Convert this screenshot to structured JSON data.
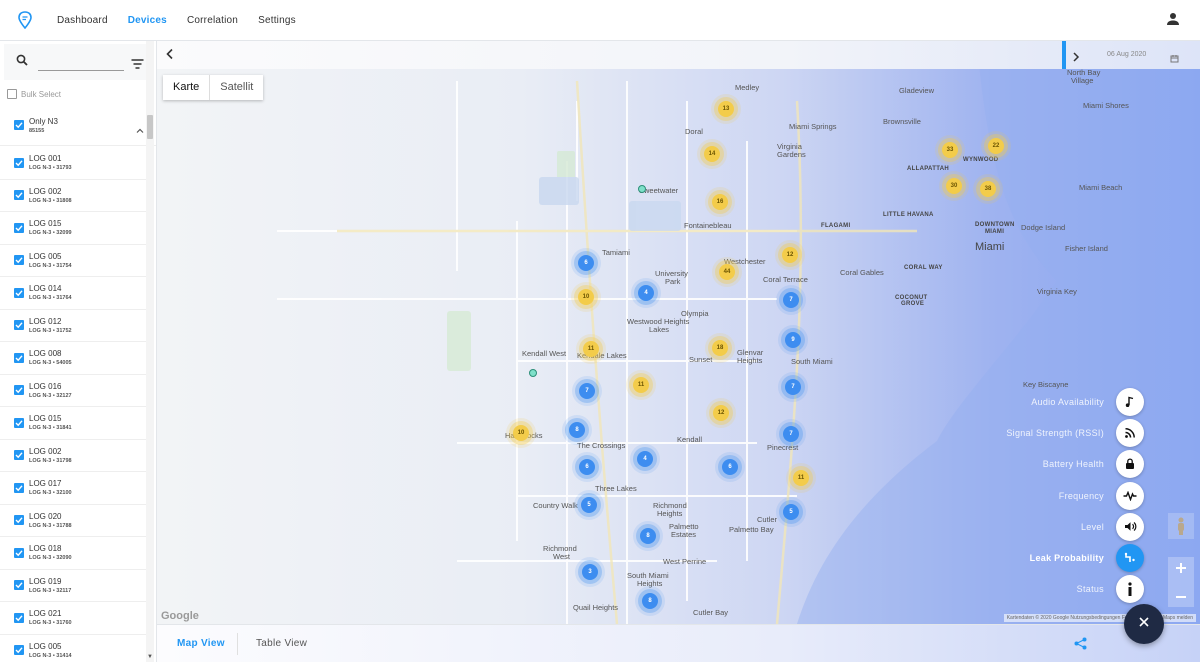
{
  "nav": {
    "items": [
      {
        "label": "Dashboard",
        "active": false
      },
      {
        "label": "Devices",
        "active": true
      },
      {
        "label": "Correlation",
        "active": false
      },
      {
        "label": "Settings",
        "active": false
      }
    ],
    "accent_color": "#2196f3"
  },
  "sidebar": {
    "search": {
      "value": "",
      "placeholder": ""
    },
    "bulk_select_label": "Bulk Select",
    "group": {
      "title": "Only N3",
      "subtitle": "85155",
      "checked": true
    },
    "items": [
      {
        "name": "LOG 001",
        "sub": "LOG N-3 • 31793"
      },
      {
        "name": "LOG 002",
        "sub": "LOG N-3 • 31808"
      },
      {
        "name": "LOG 015",
        "sub": "LOG N-3 • 32099"
      },
      {
        "name": "LOG 005",
        "sub": "LOG N-3 • 31754"
      },
      {
        "name": "LOG 014",
        "sub": "LOG N-3 • 31764"
      },
      {
        "name": "LOG 012",
        "sub": "LOG N-3 • 31752"
      },
      {
        "name": "LOG 008",
        "sub": "LOG N-3 • 54005"
      },
      {
        "name": "LOG 016",
        "sub": "LOG N-3 • 32127"
      },
      {
        "name": "LOG 015",
        "sub": "LOG N-3 • 31841"
      },
      {
        "name": "LOG 002",
        "sub": "LOG N-3 • 31798"
      },
      {
        "name": "LOG 017",
        "sub": "LOG N-3 • 32100"
      },
      {
        "name": "LOG 020",
        "sub": "LOG N-3 • 31788"
      },
      {
        "name": "LOG 018",
        "sub": "LOG N-3 • 32090"
      },
      {
        "name": "LOG 019",
        "sub": "LOG N-3 • 32117"
      },
      {
        "name": "LOG 021",
        "sub": "LOG N-3 • 31760"
      },
      {
        "name": "LOG 005",
        "sub": "LOG N-3 • 31414"
      }
    ]
  },
  "map": {
    "date": "06 Aug 2020",
    "map_type": {
      "map": "Karte",
      "satellite": "Satellit"
    },
    "places": [
      {
        "label": "Medley",
        "cls": "",
        "pos": "left:578px;top:42px"
      },
      {
        "label": "Doral",
        "cls": "",
        "pos": "left:528px;top:86px"
      },
      {
        "label": "Miami Springs",
        "cls": "",
        "pos": "left:632px;top:81px"
      },
      {
        "label": "Virginia",
        "cls": "",
        "pos": "left:620px;top:101px"
      },
      {
        "label": "Gardens",
        "cls": "",
        "pos": "left:620px;top:109px"
      },
      {
        "label": "Sweetwater",
        "cls": "",
        "pos": "left:482px;top:145px"
      },
      {
        "label": "Fontainebleau",
        "cls": "",
        "pos": "left:527px;top:180px"
      },
      {
        "label": "FLAGAMI",
        "cls": "bold",
        "pos": "left:664px;top:182px"
      },
      {
        "label": "Tamiami",
        "cls": "",
        "pos": "left:445px;top:207px"
      },
      {
        "label": "Westchester",
        "cls": "",
        "pos": "left:567px;top:216px"
      },
      {
        "label": "University",
        "cls": "",
        "pos": "left:498px;top:228px"
      },
      {
        "label": "Park",
        "cls": "",
        "pos": "left:508px;top:236px"
      },
      {
        "label": "Coral Terrace",
        "cls": "",
        "pos": "left:606px;top:234px"
      },
      {
        "label": "Coral Gables",
        "cls": "",
        "pos": "left:683px;top:227px"
      },
      {
        "label": "Olympia",
        "cls": "",
        "pos": "left:524px;top:268px"
      },
      {
        "label": "Westwood Heights",
        "cls": "",
        "pos": "left:470px;top:276px"
      },
      {
        "label": "Lakes",
        "cls": "",
        "pos": "left:492px;top:284px"
      },
      {
        "label": "Kendall West",
        "cls": "",
        "pos": "left:365px;top:308px"
      },
      {
        "label": "Kendale Lakes",
        "cls": "",
        "pos": "left:420px;top:310px"
      },
      {
        "label": "Sunset",
        "cls": "",
        "pos": "left:532px;top:314px"
      },
      {
        "label": "Glenvar",
        "cls": "",
        "pos": "left:580px;top:307px"
      },
      {
        "label": "Heights",
        "cls": "",
        "pos": "left:580px;top:315px"
      },
      {
        "label": "South Miami",
        "cls": "",
        "pos": "left:634px;top:316px"
      },
      {
        "label": "Kendall",
        "cls": "",
        "pos": "left:520px;top:394px"
      },
      {
        "label": "Pinecrest",
        "cls": "",
        "pos": "left:610px;top:402px"
      },
      {
        "label": "The Crossings",
        "cls": "",
        "pos": "left:420px;top:400px"
      },
      {
        "label": "Hammocks",
        "cls": "",
        "pos": "left:348px;top:390px"
      },
      {
        "label": "Three Lakes",
        "cls": "",
        "pos": "left:438px;top:443px"
      },
      {
        "label": "Country Walk",
        "cls": "",
        "pos": "left:376px;top:460px"
      },
      {
        "label": "Richmond",
        "cls": "",
        "pos": "left:496px;top:460px"
      },
      {
        "label": "Heights",
        "cls": "",
        "pos": "left:500px;top:468px"
      },
      {
        "label": "Palmetto",
        "cls": "",
        "pos": "left:512px;top:481px"
      },
      {
        "label": "Estates",
        "cls": "",
        "pos": "left:514px;top:489px"
      },
      {
        "label": "Cutler",
        "cls": "",
        "pos": "left:600px;top:474px"
      },
      {
        "label": "Palmetto Bay",
        "cls": "",
        "pos": "left:572px;top:484px"
      },
      {
        "label": "Richmond",
        "cls": "",
        "pos": "left:386px;top:503px"
      },
      {
        "label": "West",
        "cls": "",
        "pos": "left:396px;top:511px"
      },
      {
        "label": "West Perrine",
        "cls": "",
        "pos": "left:506px;top:516px"
      },
      {
        "label": "South Miami",
        "cls": "",
        "pos": "left:470px;top:530px"
      },
      {
        "label": "Heights",
        "cls": "",
        "pos": "left:480px;top:538px"
      },
      {
        "label": "Quail Heights",
        "cls": "",
        "pos": "left:416px;top:562px"
      },
      {
        "label": "Cutler Bay",
        "cls": "",
        "pos": "left:536px;top:567px"
      },
      {
        "label": "Gladeview",
        "cls": "",
        "pos": "left:742px;top:45px"
      },
      {
        "label": "Brownsville",
        "cls": "",
        "pos": "left:726px;top:76px"
      },
      {
        "label": "ALLAPATTAH",
        "cls": "bold",
        "pos": "left:750px;top:125px"
      },
      {
        "label": "WYNWOOD",
        "cls": "bold",
        "pos": "left:806px;top:116px"
      },
      {
        "label": "LITTLE HAVANA",
        "cls": "bold",
        "pos": "left:726px;top:171px"
      },
      {
        "label": "DOWNTOWN",
        "cls": "bold",
        "pos": "left:818px;top:181px"
      },
      {
        "label": "MIAMI",
        "cls": "bold",
        "pos": "left:828px;top:188px"
      },
      {
        "label": "Miami",
        "cls": "city",
        "pos": "left:818px;top:200px"
      },
      {
        "label": "CORAL WAY",
        "cls": "bold",
        "pos": "left:747px;top:224px"
      },
      {
        "label": "COCONUT",
        "cls": "bold",
        "pos": "left:738px;top:254px"
      },
      {
        "label": "GROVE",
        "cls": "bold",
        "pos": "left:744px;top:260px"
      },
      {
        "label": "North Bay",
        "cls": "",
        "pos": "left:910px;top:27px"
      },
      {
        "label": "Village",
        "cls": "",
        "pos": "left:914px;top:35px"
      },
      {
        "label": "Miami Shores",
        "cls": "",
        "pos": "left:926px;top:60px"
      },
      {
        "label": "Miami Beach",
        "cls": "",
        "pos": "left:922px;top:142px"
      },
      {
        "label": "Dodge Island",
        "cls": "",
        "pos": "left:864px;top:182px"
      },
      {
        "label": "Fisher Island",
        "cls": "",
        "pos": "left:908px;top:203px"
      },
      {
        "label": "Virginia Key",
        "cls": "",
        "pos": "left:880px;top:246px"
      },
      {
        "label": "Key Biscayne",
        "cls": "",
        "pos": "left:866px;top:339px"
      }
    ],
    "clusters": [
      {
        "v": "13",
        "c": "yellow",
        "pos": "left:569px;top:68px"
      },
      {
        "v": "14",
        "c": "yellow",
        "pos": "left:555px;top:113px"
      },
      {
        "v": "16",
        "c": "yellow",
        "pos": "left:563px;top:161px"
      },
      {
        "v": "12",
        "c": "yellow",
        "pos": "left:633px;top:214px"
      },
      {
        "v": "44",
        "c": "yellow",
        "pos": "left:570px;top:231px"
      },
      {
        "v": "6",
        "c": "blue",
        "pos": "left:429px;top:222px"
      },
      {
        "v": "4",
        "c": "blue",
        "pos": "left:489px;top:252px"
      },
      {
        "v": "10",
        "c": "yellow",
        "pos": "left:429px;top:256px"
      },
      {
        "v": "7",
        "c": "blue",
        "pos": "left:634px;top:259px"
      },
      {
        "v": "9",
        "c": "blue",
        "pos": "left:636px;top:299px"
      },
      {
        "v": "11",
        "c": "yellow",
        "pos": "left:434px;top:308px"
      },
      {
        "v": "18",
        "c": "yellow",
        "pos": "left:563px;top:307px"
      },
      {
        "v": "7",
        "c": "blue",
        "pos": "left:430px;top:350px"
      },
      {
        "v": "11",
        "c": "yellow",
        "pos": "left:484px;top:344px"
      },
      {
        "v": "7",
        "c": "blue",
        "pos": "left:636px;top:346px"
      },
      {
        "v": "12",
        "c": "yellow",
        "pos": "left:564px;top:372px"
      },
      {
        "v": "8",
        "c": "blue",
        "pos": "left:420px;top:389px"
      },
      {
        "v": "10",
        "c": "yellow",
        "pos": "left:364px;top:392px"
      },
      {
        "v": "7",
        "c": "blue",
        "pos": "left:634px;top:393px"
      },
      {
        "v": "4",
        "c": "blue",
        "pos": "left:488px;top:418px"
      },
      {
        "v": "6",
        "c": "blue",
        "pos": "left:430px;top:426px"
      },
      {
        "v": "6",
        "c": "blue",
        "pos": "left:573px;top:426px"
      },
      {
        "v": "11",
        "c": "yellow",
        "pos": "left:644px;top:437px"
      },
      {
        "v": "5",
        "c": "blue",
        "pos": "left:432px;top:464px"
      },
      {
        "v": "5",
        "c": "blue",
        "pos": "left:634px;top:471px"
      },
      {
        "v": "8",
        "c": "blue",
        "pos": "left:491px;top:495px"
      },
      {
        "v": "3",
        "c": "blue",
        "pos": "left:433px;top:531px"
      },
      {
        "v": "8",
        "c": "blue",
        "pos": "left:493px;top:560px"
      },
      {
        "v": "33",
        "c": "yellow",
        "pos": "left:793px;top:109px"
      },
      {
        "v": "22",
        "c": "yellow",
        "pos": "left:839px;top:105px"
      },
      {
        "v": "30",
        "c": "yellow",
        "pos": "left:797px;top:145px"
      },
      {
        "v": "38",
        "c": "yellow",
        "pos": "left:831px;top:148px"
      }
    ],
    "dots": [
      {
        "pos": "left:485px;top:148px"
      },
      {
        "pos": "left:376px;top:332px"
      }
    ],
    "google_label": "Google",
    "attribution": "Kartendaten © 2020 Google   Nutzungsbedingungen   Fehler bei Google Maps melden",
    "layers": [
      {
        "label": "Audio Availability",
        "icon": "music-note-icon",
        "active": false
      },
      {
        "label": "Signal Strength (RSSI)",
        "icon": "rss-signal-icon",
        "active": false
      },
      {
        "label": "Battery Health",
        "icon": "battery-lock-icon",
        "active": false
      },
      {
        "label": "Frequency",
        "icon": "pulse-icon",
        "active": false
      },
      {
        "label": "Level",
        "icon": "volume-icon",
        "active": false
      },
      {
        "label": "Leak Probability",
        "icon": "leak-probability-icon",
        "active": true
      },
      {
        "label": "Status",
        "icon": "info-icon",
        "active": false
      }
    ]
  },
  "bottom": {
    "tabs": [
      {
        "label": "Map View",
        "active": true
      },
      {
        "label": "Table View",
        "active": false
      }
    ]
  }
}
